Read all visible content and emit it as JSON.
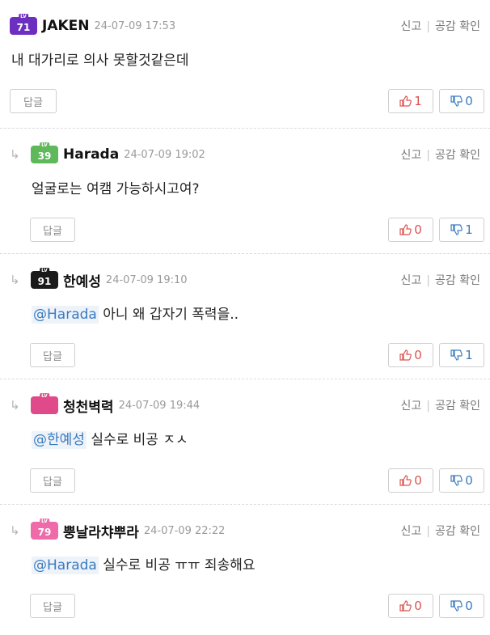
{
  "actions": {
    "report": "신고",
    "like_check": "공감 확인",
    "reply": "답글"
  },
  "comments": [
    {
      "level": "71",
      "badge_color": "#6c2fc0",
      "name": "JAKEN",
      "time": "24-07-09 17:53",
      "mention": "",
      "text": "내 대가리로 의사 못할것같은데",
      "up": "1",
      "down": "0"
    },
    {
      "level": "39",
      "badge_color": "#5fb85a",
      "name": "Harada",
      "time": "24-07-09 19:02",
      "mention": "",
      "text": "얼굴로는 여캠 가능하시고여?",
      "up": "0",
      "down": "1"
    },
    {
      "level": "91",
      "badge_color": "#1a1a1a",
      "name": "한예성",
      "time": "24-07-09 19:10",
      "mention": "@Harada",
      "text": "아니 왜 갑자기 폭력을..",
      "up": "0",
      "down": "1"
    },
    {
      "level": "",
      "badge_color": "#e04a8a",
      "name": "청천벽력",
      "time": "24-07-09 19:44",
      "mention": "@한예성",
      "text": "실수로 비공 ㅈㅅ",
      "up": "0",
      "down": "0"
    },
    {
      "level": "79",
      "badge_color": "#ef6aa8",
      "name": "뿡날라챠뿌라",
      "time": "24-07-09 22:22",
      "mention": "@Harada",
      "text": "실수로 비공 ㅠㅠ 죄송해요",
      "up": "0",
      "down": "0"
    }
  ]
}
